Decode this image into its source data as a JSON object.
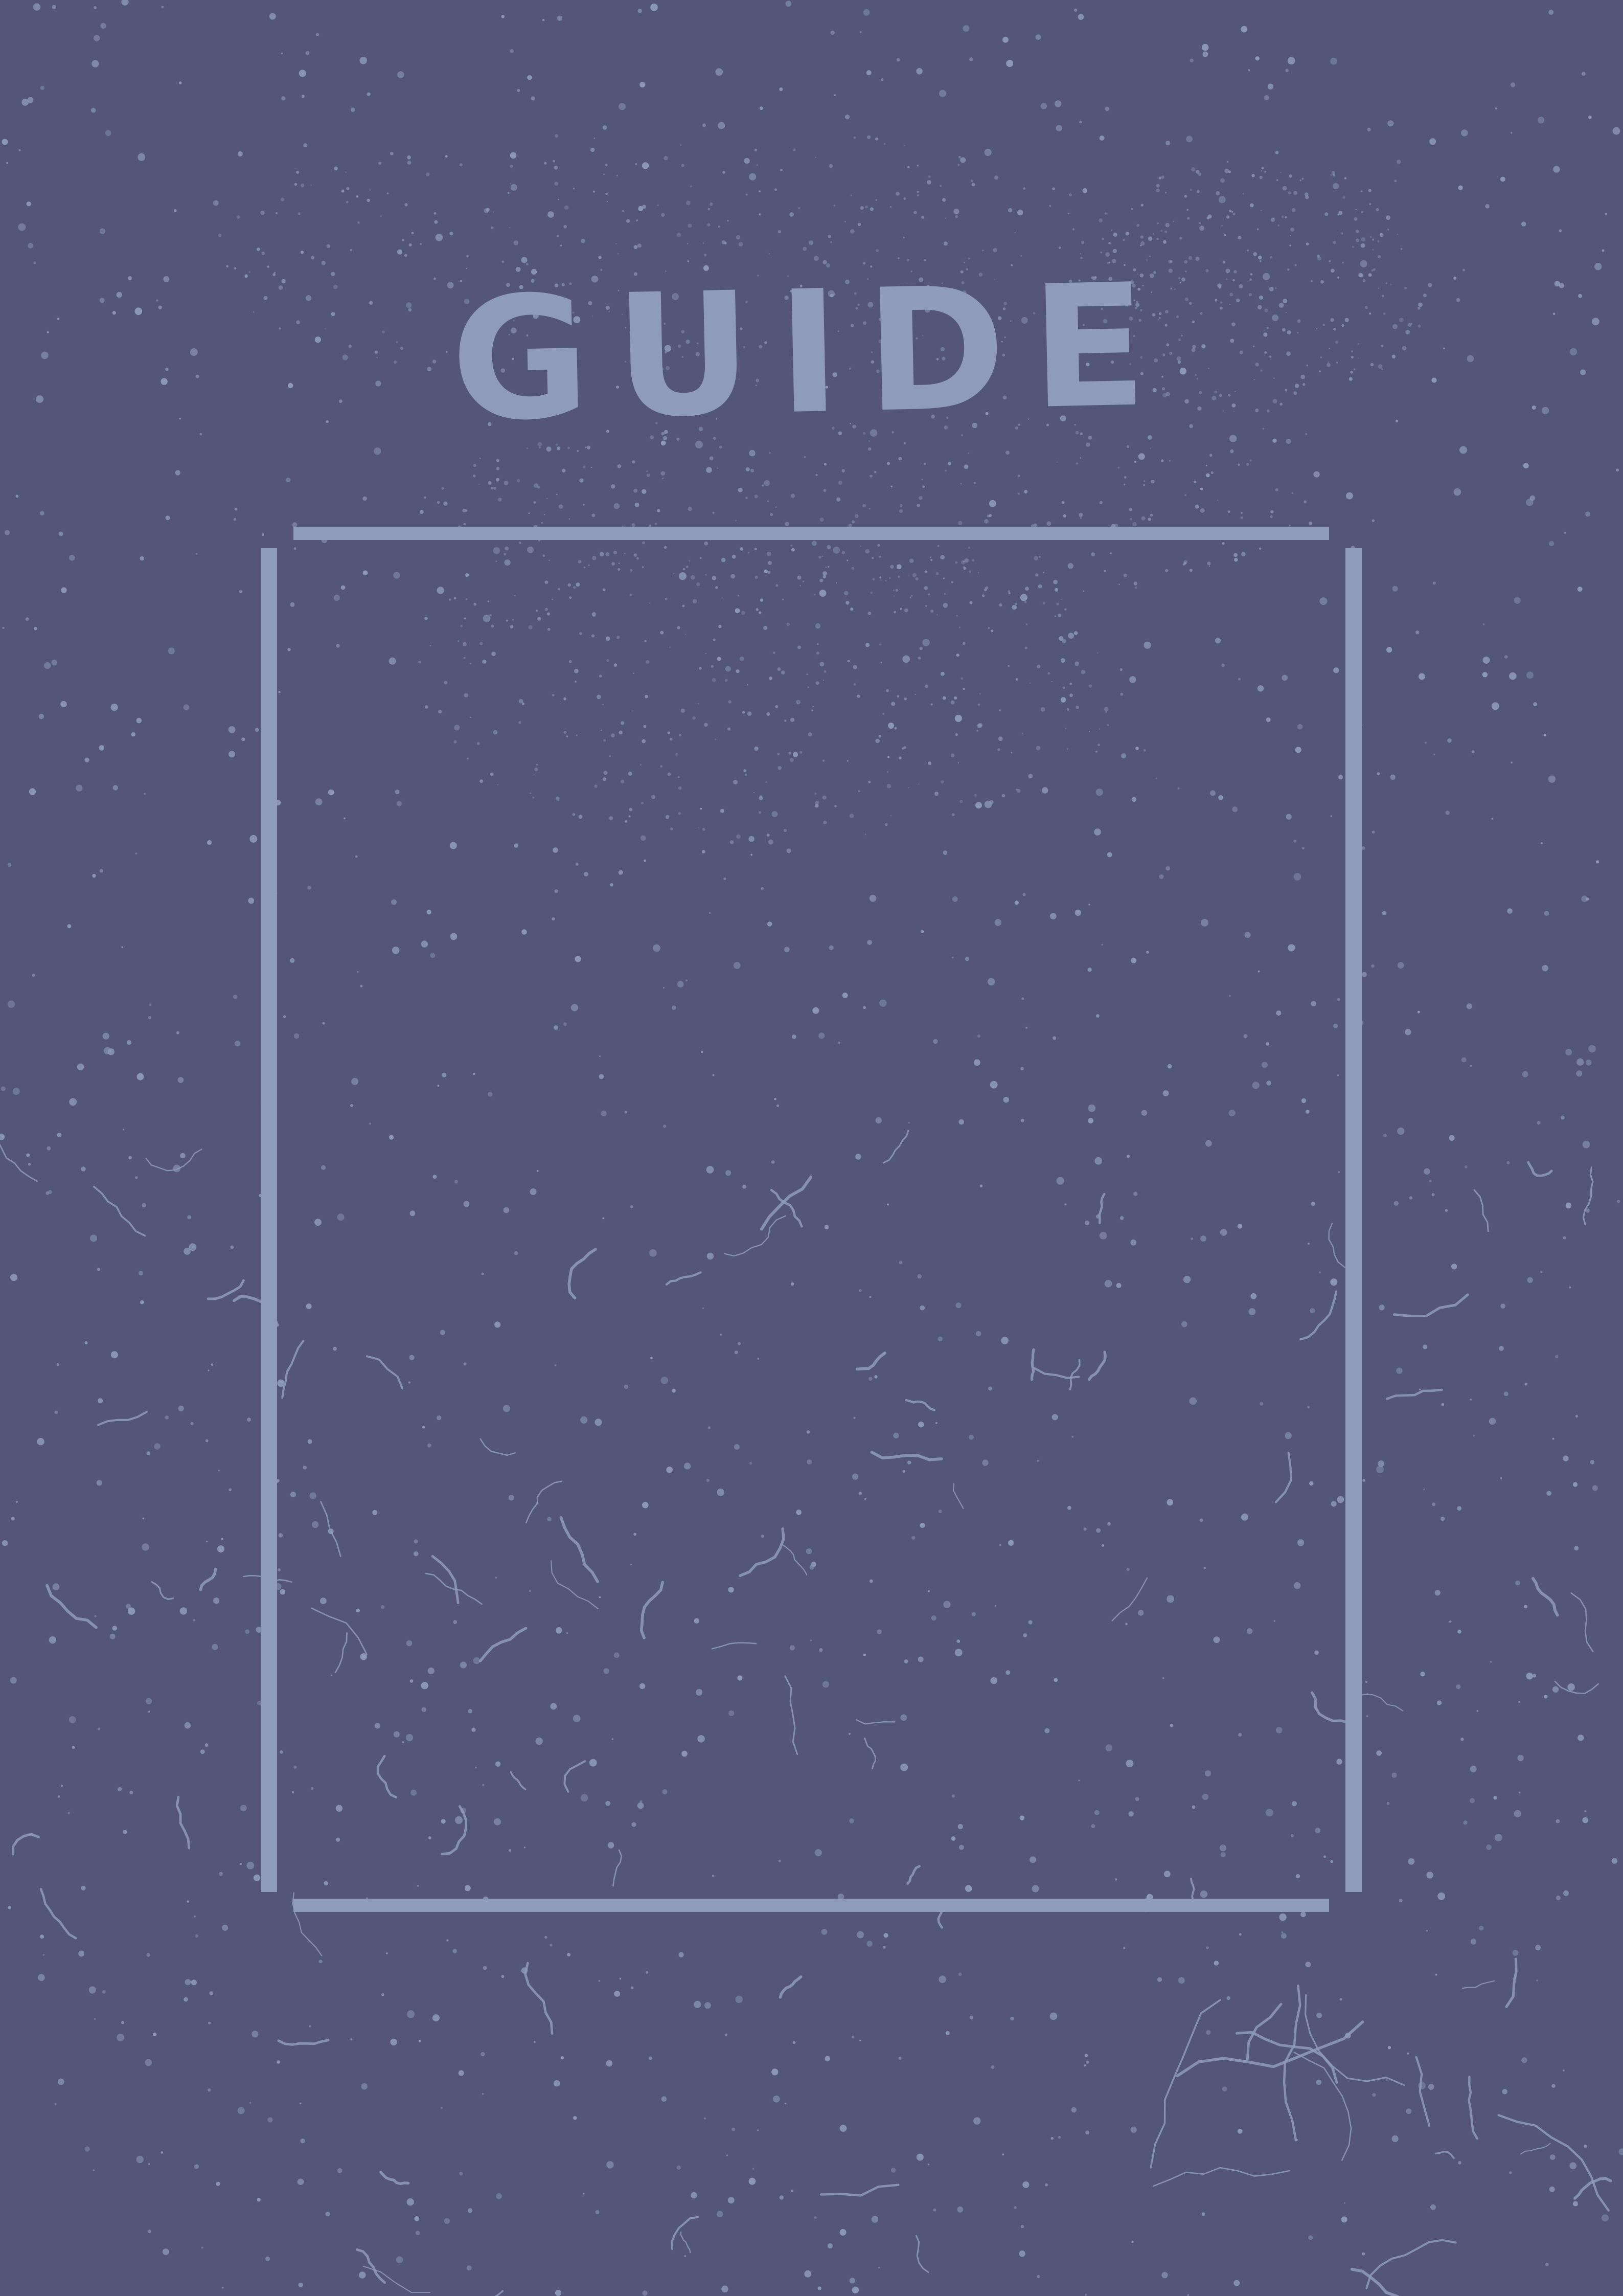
{
  "cover": {
    "title": "GUIDE"
  },
  "colors": {
    "background": "#535677",
    "accent": "#8f9bbb"
  }
}
